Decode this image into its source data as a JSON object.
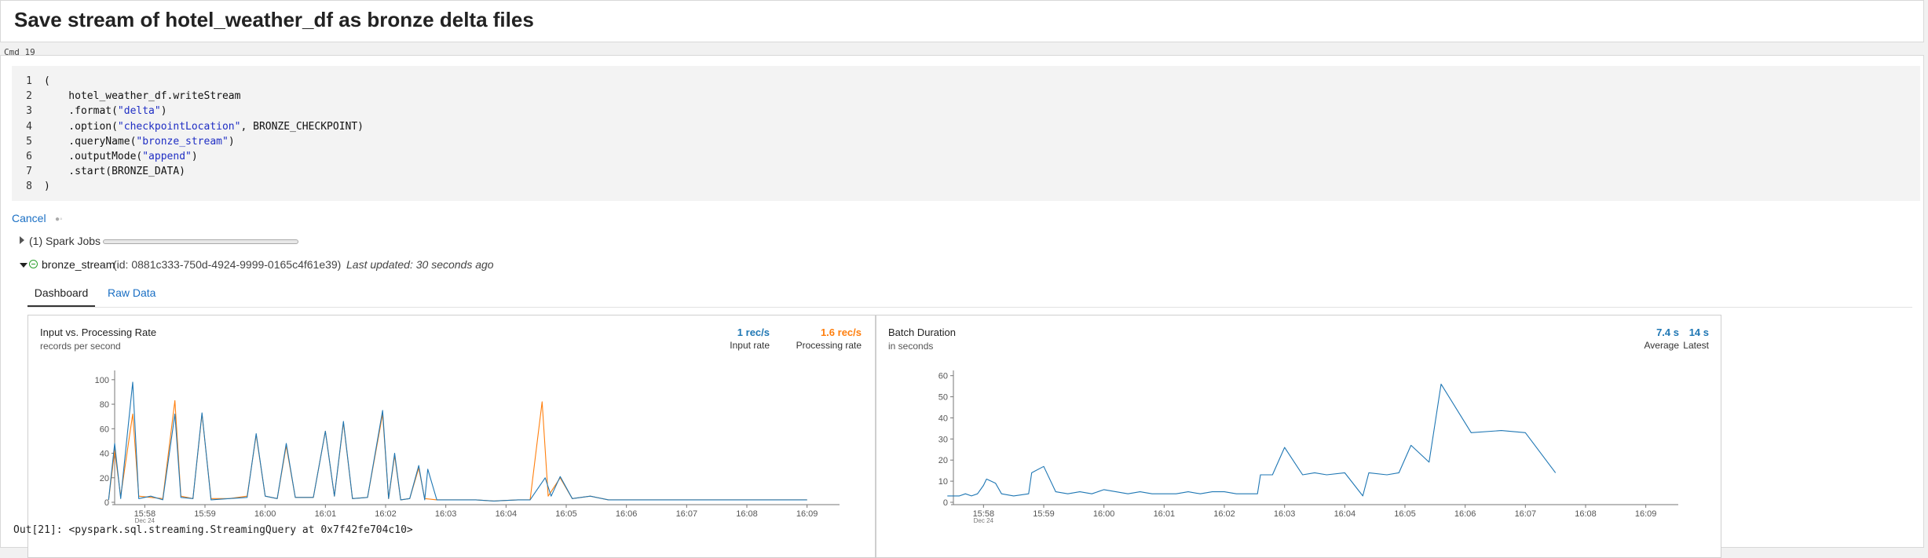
{
  "notebook": {
    "title": "Save stream of hotel_weather_df as bronze delta files",
    "cmd_label": "Cmd 19",
    "output": "Out[21]: <pyspark.sql.streaming.StreamingQuery at 0x7f42fe704c10>"
  },
  "code": {
    "lines": [
      {
        "n": "1",
        "segments": [
          {
            "t": "(",
            "s": false
          }
        ]
      },
      {
        "n": "2",
        "segments": [
          {
            "t": "    hotel_weather_df.writeStream",
            "s": false
          }
        ]
      },
      {
        "n": "3",
        "segments": [
          {
            "t": "    .format(",
            "s": false
          },
          {
            "t": "\"delta\"",
            "s": true
          },
          {
            "t": ")",
            "s": false
          }
        ]
      },
      {
        "n": "4",
        "segments": [
          {
            "t": "    .option(",
            "s": false
          },
          {
            "t": "\"checkpointLocation\"",
            "s": true
          },
          {
            "t": ", BRONZE_CHECKPOINT)",
            "s": false
          }
        ]
      },
      {
        "n": "5",
        "segments": [
          {
            "t": "    .queryName(",
            "s": false
          },
          {
            "t": "\"bronze_stream\"",
            "s": true
          },
          {
            "t": ")",
            "s": false
          }
        ]
      },
      {
        "n": "6",
        "segments": [
          {
            "t": "    .outputMode(",
            "s": false
          },
          {
            "t": "\"append\"",
            "s": true
          },
          {
            "t": ")",
            "s": false
          }
        ]
      },
      {
        "n": "7",
        "segments": [
          {
            "t": "    .start(BRONZE_DATA)",
            "s": false
          }
        ]
      },
      {
        "n": "8",
        "segments": [
          {
            "t": ")",
            "s": false
          }
        ]
      }
    ]
  },
  "execution": {
    "cancel_label": "Cancel",
    "spark_jobs_label": "(1) Spark Jobs"
  },
  "stream": {
    "name": "bronze_stream",
    "id_text": "(id: 0881c333-750d-4924-9999-0165c4f61e39)",
    "updated_text": "Last updated: 30 seconds ago",
    "tabs": [
      {
        "label": "Dashboard",
        "active": true
      },
      {
        "label": "Raw Data",
        "active": false
      }
    ]
  },
  "colors": {
    "input": "#1f77b4",
    "processing": "#ff7f0e",
    "accent_link": "#1a6fc4",
    "status_green": "#2ca02c"
  },
  "chart_data": [
    {
      "type": "line",
      "title": "Input vs. Processing Rate",
      "subtitle": "records per second",
      "stats": [
        {
          "value": "1 rec/s",
          "label": "Input rate",
          "color": "#1f77b4"
        },
        {
          "value": "1.6 rec/s",
          "label": "Processing rate",
          "color": "#ff7f0e"
        }
      ],
      "ylim": [
        0,
        105
      ],
      "xlim": [
        957.5,
        969.5
      ],
      "yticks": [
        0,
        20,
        40,
        60,
        80,
        100
      ],
      "xticks": [
        {
          "x": 958,
          "label": "15:58",
          "sub": "Dec 24"
        },
        {
          "x": 959,
          "label": "15:59"
        },
        {
          "x": 960,
          "label": "16:00"
        },
        {
          "x": 961,
          "label": "16:01"
        },
        {
          "x": 962,
          "label": "16:02"
        },
        {
          "x": 963,
          "label": "16:03"
        },
        {
          "x": 964,
          "label": "16:04"
        },
        {
          "x": 965,
          "label": "16:05"
        },
        {
          "x": 966,
          "label": "16:06"
        },
        {
          "x": 967,
          "label": "16:07"
        },
        {
          "x": 968,
          "label": "16:08"
        },
        {
          "x": 969,
          "label": "16:09"
        }
      ],
      "series": [
        {
          "name": "Input rate",
          "color": "#1f77b4",
          "points": [
            [
              957.4,
              2
            ],
            [
              957.5,
              48
            ],
            [
              957.6,
              3
            ],
            [
              957.8,
              98
            ],
            [
              957.9,
              3
            ],
            [
              958.1,
              5
            ],
            [
              958.3,
              2
            ],
            [
              958.5,
              72
            ],
            [
              958.6,
              4
            ],
            [
              958.8,
              3
            ],
            [
              958.95,
              73
            ],
            [
              959.1,
              2
            ],
            [
              959.4,
              3
            ],
            [
              959.7,
              4
            ],
            [
              959.85,
              56
            ],
            [
              960.0,
              5
            ],
            [
              960.2,
              3
            ],
            [
              960.35,
              48
            ],
            [
              960.5,
              4
            ],
            [
              960.8,
              4
            ],
            [
              961.0,
              58
            ],
            [
              961.15,
              5
            ],
            [
              961.3,
              66
            ],
            [
              961.45,
              3
            ],
            [
              961.7,
              4
            ],
            [
              961.95,
              75
            ],
            [
              962.05,
              3
            ],
            [
              962.15,
              40
            ],
            [
              962.25,
              2
            ],
            [
              962.4,
              3
            ],
            [
              962.55,
              30
            ],
            [
              962.65,
              2
            ],
            [
              962.7,
              27
            ],
            [
              962.85,
              2
            ],
            [
              963.1,
              2
            ],
            [
              963.5,
              2
            ],
            [
              963.8,
              1
            ],
            [
              964.2,
              2
            ],
            [
              964.4,
              2
            ],
            [
              964.65,
              20
            ],
            [
              964.75,
              5
            ],
            [
              964.9,
              21
            ],
            [
              965.1,
              3
            ],
            [
              965.4,
              5
            ],
            [
              965.7,
              2
            ],
            [
              966.0,
              2
            ],
            [
              966.5,
              2
            ],
            [
              967.0,
              2
            ],
            [
              967.5,
              2
            ],
            [
              968.0,
              2
            ],
            [
              968.5,
              2
            ],
            [
              969.0,
              2
            ]
          ]
        },
        {
          "name": "Processing rate",
          "color": "#ff7f0e",
          "points": [
            [
              957.4,
              2
            ],
            [
              957.5,
              42
            ],
            [
              957.6,
              5
            ],
            [
              957.8,
              72
            ],
            [
              957.9,
              5
            ],
            [
              958.1,
              4
            ],
            [
              958.3,
              3
            ],
            [
              958.5,
              83
            ],
            [
              958.6,
              5
            ],
            [
              958.8,
              3
            ],
            [
              958.95,
              72
            ],
            [
              959.1,
              3
            ],
            [
              959.4,
              3
            ],
            [
              959.7,
              5
            ],
            [
              959.85,
              55
            ],
            [
              960.0,
              5
            ],
            [
              960.2,
              3
            ],
            [
              960.35,
              46
            ],
            [
              960.5,
              4
            ],
            [
              960.8,
              4
            ],
            [
              961.0,
              58
            ],
            [
              961.15,
              5
            ],
            [
              961.3,
              65
            ],
            [
              961.45,
              3
            ],
            [
              961.7,
              4
            ],
            [
              961.95,
              72
            ],
            [
              962.05,
              3
            ],
            [
              962.15,
              38
            ],
            [
              962.25,
              2
            ],
            [
              962.4,
              3
            ],
            [
              962.55,
              28
            ],
            [
              962.65,
              3
            ],
            [
              962.85,
              2
            ],
            [
              963.1,
              2
            ],
            [
              963.5,
              2
            ],
            [
              963.8,
              1
            ],
            [
              964.2,
              2
            ],
            [
              964.4,
              2
            ],
            [
              964.6,
              82
            ],
            [
              964.7,
              5
            ],
            [
              964.9,
              20
            ],
            [
              965.1,
              3
            ],
            [
              965.4,
              5
            ],
            [
              965.7,
              2
            ],
            [
              966.0,
              2
            ],
            [
              966.5,
              2
            ],
            [
              967.0,
              2
            ],
            [
              967.5,
              2
            ],
            [
              968.0,
              2
            ],
            [
              968.5,
              2
            ],
            [
              969.0,
              2
            ]
          ]
        }
      ]
    },
    {
      "type": "line",
      "title": "Batch Duration",
      "subtitle": "in seconds",
      "stats": [
        {
          "value": "7.4 s",
          "label": "Average",
          "color": "#1f77b4"
        },
        {
          "value": "14 s",
          "label": "Latest",
          "color": "#1f77b4"
        }
      ],
      "ylim": [
        0,
        61
      ],
      "xlim": [
        957.5,
        969.5
      ],
      "yticks": [
        0,
        10,
        20,
        30,
        40,
        50,
        60
      ],
      "xticks": [
        {
          "x": 958,
          "label": "15:58",
          "sub": "Dec 24"
        },
        {
          "x": 959,
          "label": "15:59"
        },
        {
          "x": 960,
          "label": "16:00"
        },
        {
          "x": 961,
          "label": "16:01"
        },
        {
          "x": 962,
          "label": "16:02"
        },
        {
          "x": 963,
          "label": "16:03"
        },
        {
          "x": 964,
          "label": "16:04"
        },
        {
          "x": 965,
          "label": "16:05"
        },
        {
          "x": 966,
          "label": "16:06"
        },
        {
          "x": 967,
          "label": "16:07"
        },
        {
          "x": 968,
          "label": "16:08"
        },
        {
          "x": 969,
          "label": "16:09"
        }
      ],
      "series": [
        {
          "name": "Batch duration",
          "color": "#1f77b4",
          "points": [
            [
              957.4,
              3
            ],
            [
              957.6,
              3
            ],
            [
              957.7,
              4
            ],
            [
              957.8,
              3
            ],
            [
              957.9,
              4
            ],
            [
              958.0,
              8
            ],
            [
              958.05,
              11
            ],
            [
              958.2,
              9
            ],
            [
              958.3,
              4
            ],
            [
              958.5,
              3
            ],
            [
              958.75,
              4
            ],
            [
              958.8,
              14
            ],
            [
              959.0,
              17
            ],
            [
              959.2,
              5
            ],
            [
              959.4,
              4
            ],
            [
              959.6,
              5
            ],
            [
              959.8,
              4
            ],
            [
              960.0,
              6
            ],
            [
              960.2,
              5
            ],
            [
              960.4,
              4
            ],
            [
              960.6,
              5
            ],
            [
              960.8,
              4
            ],
            [
              961.0,
              4
            ],
            [
              961.2,
              4
            ],
            [
              961.4,
              5
            ],
            [
              961.6,
              4
            ],
            [
              961.8,
              5
            ],
            [
              962.0,
              5
            ],
            [
              962.2,
              4
            ],
            [
              962.4,
              4
            ],
            [
              962.55,
              4
            ],
            [
              962.6,
              13
            ],
            [
              962.8,
              13
            ],
            [
              963.0,
              26
            ],
            [
              963.3,
              13
            ],
            [
              963.5,
              14
            ],
            [
              963.7,
              13
            ],
            [
              964.0,
              14
            ],
            [
              964.3,
              3
            ],
            [
              964.4,
              14
            ],
            [
              964.7,
              13
            ],
            [
              964.9,
              14
            ],
            [
              965.1,
              27
            ],
            [
              965.4,
              19
            ],
            [
              965.6,
              56
            ],
            [
              966.1,
              33
            ],
            [
              966.6,
              34
            ],
            [
              967.0,
              33
            ],
            [
              967.5,
              14
            ]
          ]
        }
      ]
    }
  ]
}
